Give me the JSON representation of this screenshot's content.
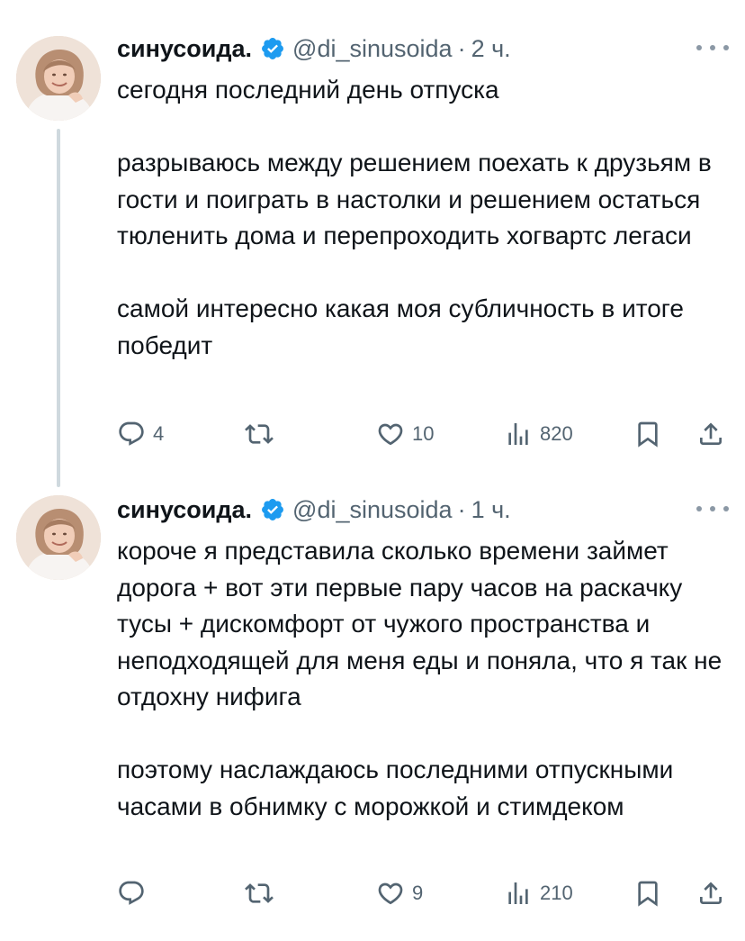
{
  "tweets": [
    {
      "display_name": "синусоида.",
      "handle": "@di_sinusoida",
      "dot": "·",
      "time": "2 ч.",
      "text": "сегодня последний день отпуска\n\nразрываюсь между решением поехать к друзьям в гости и поиграть в настолки и решением остаться тюленить дома и перепроходить хогвартс легаси\n\nсамой интересно какая моя субличность в итоге победит",
      "reply_count": "4",
      "retweet_count": "",
      "like_count": "10",
      "view_count": "820"
    },
    {
      "display_name": "синусоида.",
      "handle": "@di_sinusoida",
      "dot": "·",
      "time": "1 ч.",
      "text": "короче я представила сколько времени займет дорога + вот эти первые пару часов на раскачку тусы + дискомфорт от чужого пространства и неподходящей для меня еды и поняла, что я так не отдохну нифига\n\nпоэтому наслаждаюсь последними отпускными часами в обнимку с морожкой и стимдеком",
      "reply_count": "",
      "retweet_count": "",
      "like_count": "9",
      "view_count": "210"
    }
  ],
  "icons": {
    "verified": "verified-badge-icon",
    "more": "more-horizontal-icon",
    "reply": "reply-icon",
    "retweet": "retweet-icon",
    "like": "heart-icon",
    "views": "views-icon",
    "bookmark": "bookmark-icon",
    "share": "share-icon"
  },
  "colors": {
    "text": "#0f1419",
    "secondary": "#536471",
    "verified": "#1d9bf0",
    "thread_line": "#cfd9de"
  }
}
